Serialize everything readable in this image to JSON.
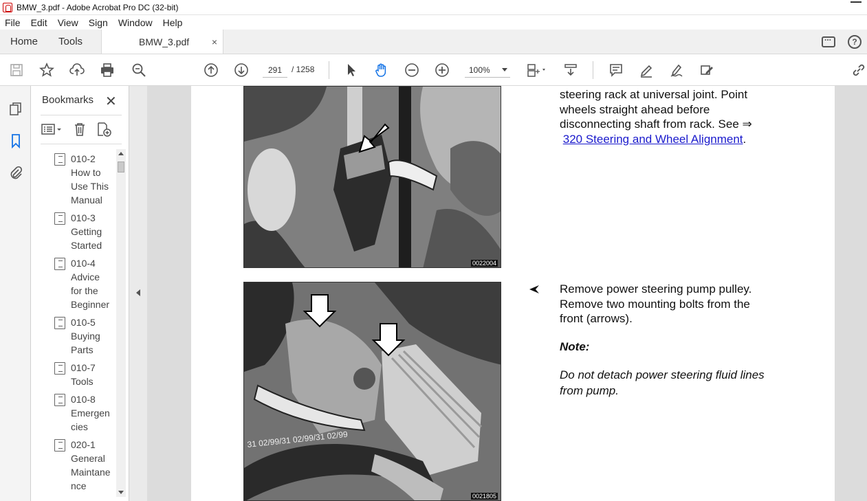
{
  "window": {
    "title": "BMW_3.pdf - Adobe Acrobat Pro DC (32-bit)"
  },
  "menu": [
    "File",
    "Edit",
    "View",
    "Sign",
    "Window",
    "Help"
  ],
  "tabs": {
    "home": "Home",
    "tools": "Tools",
    "document": "BMW_3.pdf",
    "close_glyph": "×"
  },
  "toolbar": {
    "page_current": "291",
    "page_total": "/ 1258",
    "zoom": "100%"
  },
  "bookmarks": {
    "title": "Bookmarks",
    "close_glyph": "✕",
    "items": [
      "010-2\nHow to\nUse This\nManual",
      "010-3\nGetting\nStarted",
      "010-4\nAdvice\nfor the\nBeginner",
      "010-5\nBuying\nParts",
      "010-7\nTools",
      "010-8\nEmergen\ncies",
      "020-1\nGeneral\nMaintane\nnce"
    ]
  },
  "content": {
    "para1_line1": "steering rack at universal joint. Point",
    "para1_line2": "wheels straight ahead before",
    "para1_line3": "disconnecting shaft from rack. See ⇒",
    "para1_link": "320 Steering and Wheel Alignment",
    "para1_end": ".",
    "photo1_code": "0022004",
    "para2_line1": "Remove power steering pump pulley.",
    "para2_line2": "Remove two mounting bolts from the",
    "para2_line3": "front (arrows).",
    "note_label": "Note:",
    "note_line1": "Do not detach power steering fluid lines",
    "note_line2": "from pump.",
    "photo2_code": "0021805",
    "hose_stamp": "31 02/99/31 02/99/31 02/99"
  }
}
